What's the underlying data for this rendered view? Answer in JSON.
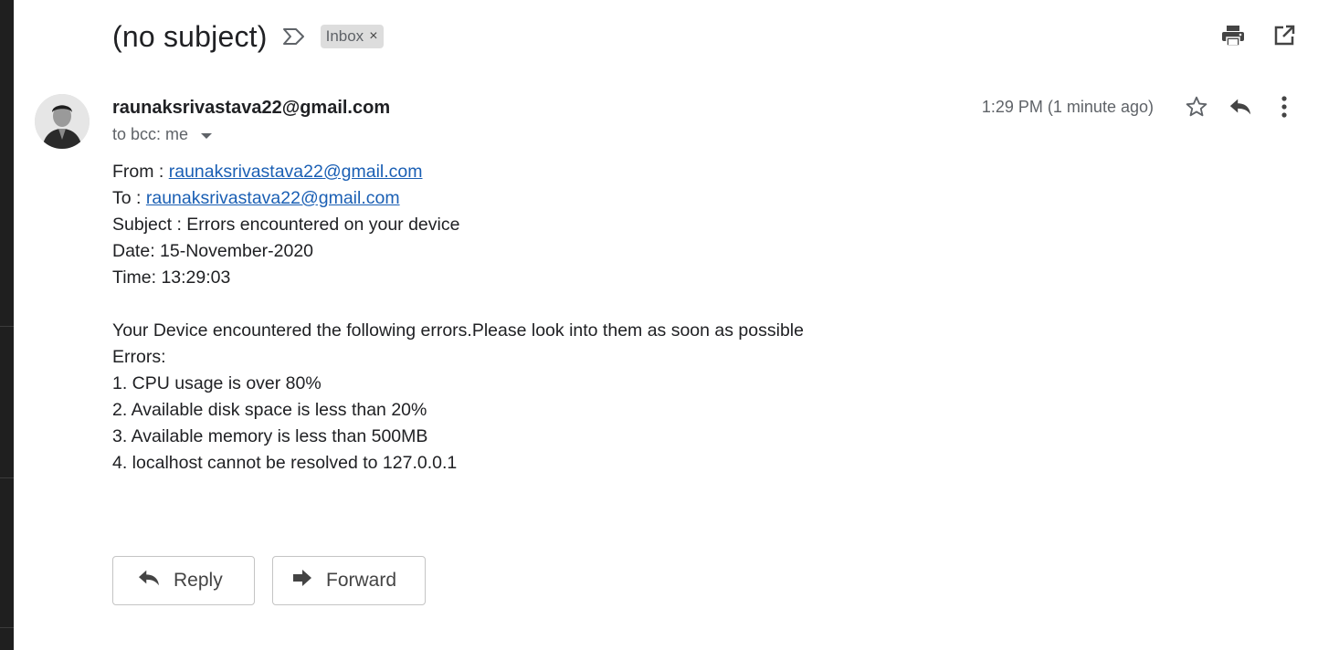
{
  "header": {
    "subject": "(no subject)",
    "label": "Inbox",
    "label_remove": "×"
  },
  "message": {
    "sender": "raunaksrivastava22@gmail.com",
    "recipients": "to bcc: me",
    "time": "1:29 PM (1 minute ago)"
  },
  "body": {
    "from_label": "From : ",
    "from_email": "raunaksrivastava22@gmail.com",
    "to_label": "To : ",
    "to_email": "raunaksrivastava22@gmail.com",
    "subject_line": "Subject : Errors encountered on your device",
    "date_line": "Date: 15-November-2020",
    "time_line": "Time: 13:29:03",
    "intro": "Your Device encountered the following errors.Please look into them as soon as possible",
    "errors_heading": "Errors:",
    "errors": [
      "1. CPU usage is over 80%",
      "2. Available disk space is less than 20%",
      "3. Available memory is less than 500MB",
      "4. localhost cannot be resolved to 127.0.0.1"
    ]
  },
  "actions": {
    "reply_label": "Reply",
    "forward_label": "Forward"
  },
  "icons": {
    "importance": "importance-marker-icon",
    "print": "print-icon",
    "open_new_window": "open-in-new-window-icon",
    "star": "star-icon",
    "reply": "reply-icon",
    "more": "more-vert-icon",
    "forward": "forward-icon"
  },
  "colors": {
    "link": "#1a5fb4",
    "label_bg": "#dddddd",
    "icon": "#5f6368"
  }
}
